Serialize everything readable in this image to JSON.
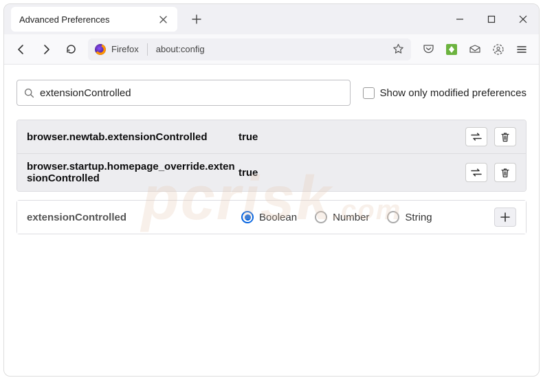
{
  "window": {
    "tab_title": "Advanced Preferences",
    "url_label": "Firefox",
    "url": "about:config"
  },
  "search": {
    "value": "extensionControlled",
    "show_modified_label": "Show only modified preferences"
  },
  "results": [
    {
      "name": "browser.newtab.extensionControlled",
      "value": "true"
    },
    {
      "name": "browser.startup.homepage_override.extensionControlled",
      "value": "true"
    }
  ],
  "new_pref": {
    "name": "extensionControlled",
    "types": {
      "boolean": "Boolean",
      "number": "Number",
      "string": "String"
    }
  },
  "watermark": {
    "main": "pcrisk",
    "tld": ".com"
  }
}
